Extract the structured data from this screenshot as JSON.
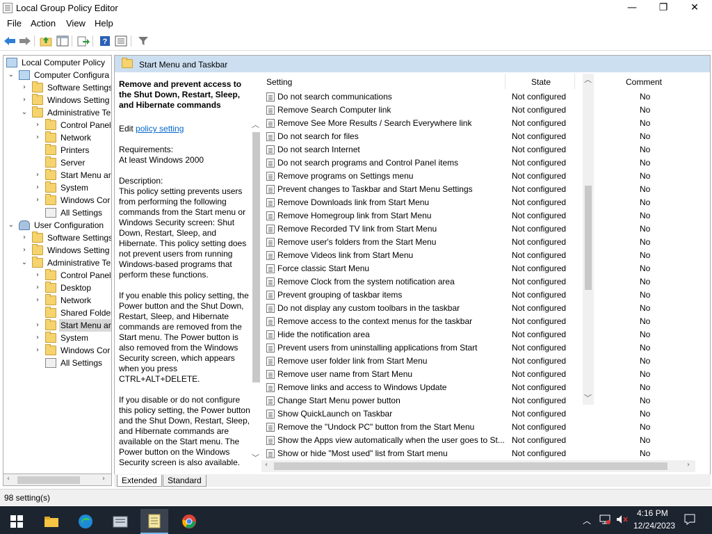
{
  "window": {
    "title": "Local Group Policy Editor",
    "minimize_glyph": "—",
    "maximize_glyph": "❐",
    "close_glyph": "✕"
  },
  "menu": [
    "File",
    "Action",
    "View",
    "Help"
  ],
  "toolbar_icons": [
    "back-icon",
    "forward-icon",
    "up-folder-icon",
    "show-hide-tree-icon",
    "export-list-icon",
    "help-icon",
    "properties-icon",
    "filter-icon"
  ],
  "tree": {
    "root": "Local Computer Policy",
    "computer_config": "Computer Configura",
    "cc_software": "Software Settings",
    "cc_windows": "Windows Setting",
    "cc_admin": "Administrative Te",
    "cc_control_panel": "Control Panel",
    "cc_network": "Network",
    "cc_printers": "Printers",
    "cc_server": "Server",
    "cc_start_menu": "Start Menu ar",
    "cc_system": "System",
    "cc_windows_comp": "Windows Cor",
    "cc_all_settings": "All Settings",
    "user_config": "User Configuration",
    "uc_software": "Software Settings",
    "uc_windows": "Windows Setting",
    "uc_admin": "Administrative Te",
    "uc_control_panel": "Control Panel",
    "uc_desktop": "Desktop",
    "uc_network": "Network",
    "uc_shared": "Shared Folder",
    "uc_start_menu": "Start Menu ar",
    "uc_system": "System",
    "uc_windows_comp": "Windows Cor",
    "uc_all_settings": "All Settings"
  },
  "header": {
    "title": "Start Menu and Taskbar"
  },
  "description": {
    "heading": "Remove and prevent access to the Shut Down, Restart, Sleep, and Hibernate commands",
    "edit_prefix": "Edit ",
    "edit_link": "policy setting",
    "requirements_label": "Requirements:",
    "requirements_value": "At least Windows 2000",
    "description_label": "Description:",
    "para1": "This policy setting prevents users from performing the following commands from the Start menu or Windows Security screen: Shut Down, Restart, Sleep, and Hibernate. This policy setting does not prevent users from running Windows-based programs that perform these functions.",
    "para2": "If you enable this policy setting, the Power button and the Shut Down, Restart, Sleep, and Hibernate commands are removed from the Start menu. The Power button is also removed from the Windows Security screen, which appears when you press CTRL+ALT+DELETE.",
    "para3": "If you disable or do not configure this policy setting, the Power button and the Shut Down, Restart, Sleep, and Hibernate commands are available on the Start menu. The Power button on the Windows Security screen is also available."
  },
  "list": {
    "columns": {
      "setting": "Setting",
      "state": "State",
      "comment": "Comment"
    },
    "rows": [
      {
        "setting": "Do not search communications",
        "state": "Not configured",
        "comment": "No"
      },
      {
        "setting": "Remove Search Computer link",
        "state": "Not configured",
        "comment": "No"
      },
      {
        "setting": "Remove See More Results / Search Everywhere link",
        "state": "Not configured",
        "comment": "No"
      },
      {
        "setting": "Do not search for files",
        "state": "Not configured",
        "comment": "No"
      },
      {
        "setting": "Do not search Internet",
        "state": "Not configured",
        "comment": "No"
      },
      {
        "setting": "Do not search programs and Control Panel items",
        "state": "Not configured",
        "comment": "No"
      },
      {
        "setting": "Remove programs on Settings menu",
        "state": "Not configured",
        "comment": "No"
      },
      {
        "setting": "Prevent changes to Taskbar and Start Menu Settings",
        "state": "Not configured",
        "comment": "No"
      },
      {
        "setting": "Remove Downloads link from Start Menu",
        "state": "Not configured",
        "comment": "No"
      },
      {
        "setting": "Remove Homegroup link from Start Menu",
        "state": "Not configured",
        "comment": "No"
      },
      {
        "setting": "Remove Recorded TV link from Start Menu",
        "state": "Not configured",
        "comment": "No"
      },
      {
        "setting": "Remove user's folders from the Start Menu",
        "state": "Not configured",
        "comment": "No"
      },
      {
        "setting": "Remove Videos link from Start Menu",
        "state": "Not configured",
        "comment": "No"
      },
      {
        "setting": "Force classic Start Menu",
        "state": "Not configured",
        "comment": "No"
      },
      {
        "setting": "Remove Clock from the system notification area",
        "state": "Not configured",
        "comment": "No"
      },
      {
        "setting": "Prevent grouping of taskbar items",
        "state": "Not configured",
        "comment": "No"
      },
      {
        "setting": "Do not display any custom toolbars in the taskbar",
        "state": "Not configured",
        "comment": "No"
      },
      {
        "setting": "Remove access to the context menus for the taskbar",
        "state": "Not configured",
        "comment": "No"
      },
      {
        "setting": "Hide the notification area",
        "state": "Not configured",
        "comment": "No"
      },
      {
        "setting": "Prevent users from uninstalling applications from Start",
        "state": "Not configured",
        "comment": "No"
      },
      {
        "setting": "Remove user folder link from Start Menu",
        "state": "Not configured",
        "comment": "No"
      },
      {
        "setting": "Remove user name from Start Menu",
        "state": "Not configured",
        "comment": "No"
      },
      {
        "setting": "Remove links and access to Windows Update",
        "state": "Not configured",
        "comment": "No"
      },
      {
        "setting": "Change Start Menu power button",
        "state": "Not configured",
        "comment": "No"
      },
      {
        "setting": "Show QuickLaunch on Taskbar",
        "state": "Not configured",
        "comment": "No"
      },
      {
        "setting": "Remove the \"Undock PC\" button from the Start Menu",
        "state": "Not configured",
        "comment": "No"
      },
      {
        "setting": "Show the Apps view automatically when the user goes to St...",
        "state": "Not configured",
        "comment": "No"
      },
      {
        "setting": "Show or hide \"Most used\" list from Start menu",
        "state": "Not configured",
        "comment": "No"
      }
    ]
  },
  "tabs": {
    "extended": "Extended",
    "standard": "Standard"
  },
  "status": {
    "text": "98 setting(s)"
  },
  "taskbar": {
    "apps": [
      "windows-start-icon",
      "file-explorer-icon",
      "edge-icon",
      "server-manager-icon",
      "notepad-icon",
      "chrome-icon"
    ],
    "time": "4:16 PM",
    "date": "12/24/2023"
  },
  "colors": {
    "accent": "#0066cc",
    "header_band": "#ccdff0",
    "taskbar": "#1c2430"
  }
}
